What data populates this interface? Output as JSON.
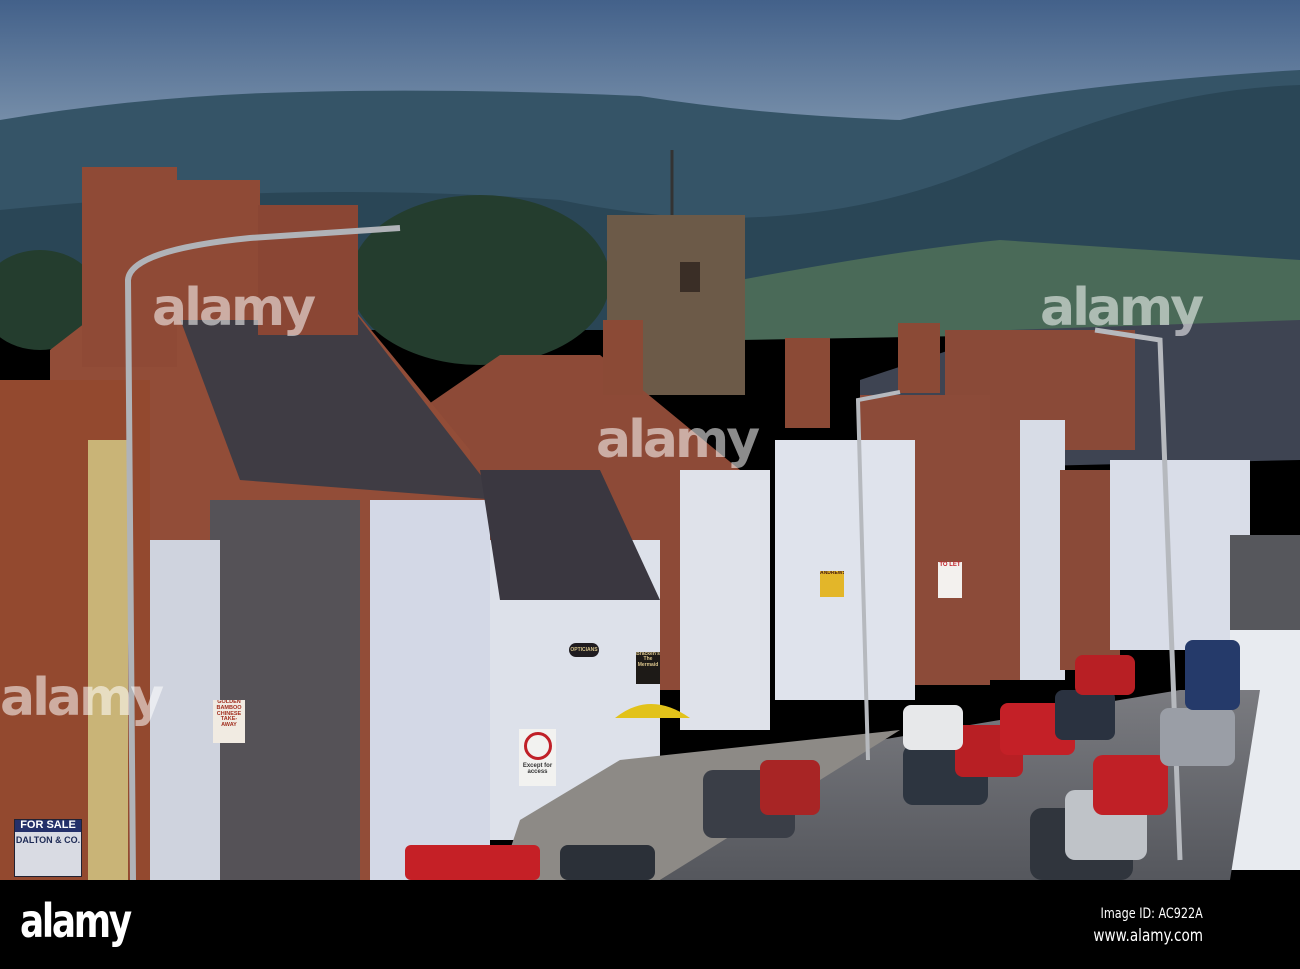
{
  "footer": {
    "logo": "alamy",
    "image_id": "Image ID: AC922A",
    "url": "www.alamy.com"
  },
  "watermark": "alamy",
  "signs": {
    "for_sale": "FOR SALE",
    "agent": "DALTON & CO.",
    "takeaway": "GOLDEN BAMBOO CHINESE TAKE-AWAY",
    "opticians": "OPTICIANS",
    "pub": "Bracken's The Mermaid",
    "andrews": "ANDREWS",
    "to_let": "TO LET",
    "no_entry": "Except for access"
  },
  "colors": {
    "sky": "#4f6f95",
    "hills": "#2d4a5c",
    "brick": "#8c4b39",
    "render": "#d9dde9",
    "road": "#5f6168"
  }
}
